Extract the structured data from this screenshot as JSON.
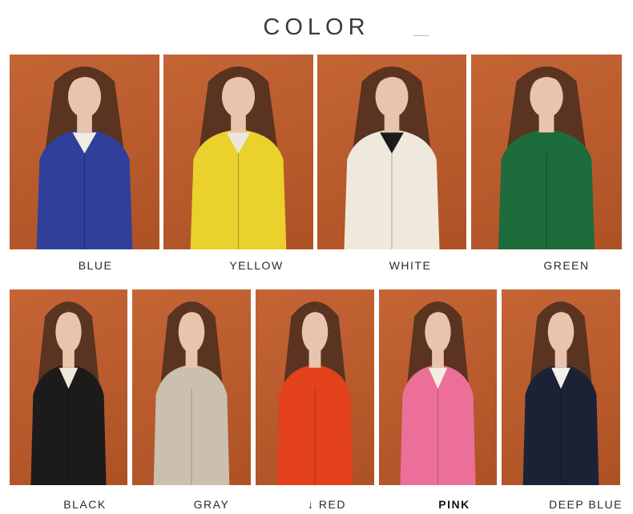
{
  "title": "COLOR",
  "row1": [
    {
      "label": "BLUE",
      "garment": "#2f3f9a",
      "inner": "#f0ece4"
    },
    {
      "label": "YELLOW",
      "garment": "#ead12c",
      "inner": "#ece7dd"
    },
    {
      "label": "WHITE",
      "garment": "#efe8dd",
      "inner": "#1b1b1b"
    },
    {
      "label": "GREEN",
      "garment": "#1e6b3c",
      "inner": "#1e6b3c"
    }
  ],
  "row2": [
    {
      "label": "BLACK",
      "garment": "#1c1a1b",
      "inner": "#efe8dd"
    },
    {
      "label": "GRAY",
      "garment": "#cbbfae",
      "inner": "#cbbfae"
    },
    {
      "label": "↓ RED",
      "garment": "#e3401c",
      "inner": "#e3401c"
    },
    {
      "label": "PINK",
      "garment": "#ec6f9a",
      "inner": "#f3ede4"
    },
    {
      "label": "DEEP BLUE",
      "garment": "#1b2236",
      "inner": "#f3f1ee"
    }
  ],
  "colors": {
    "backdrop": "#c15b29",
    "hair": "#5a3321",
    "skin": "#e9c4ad"
  }
}
